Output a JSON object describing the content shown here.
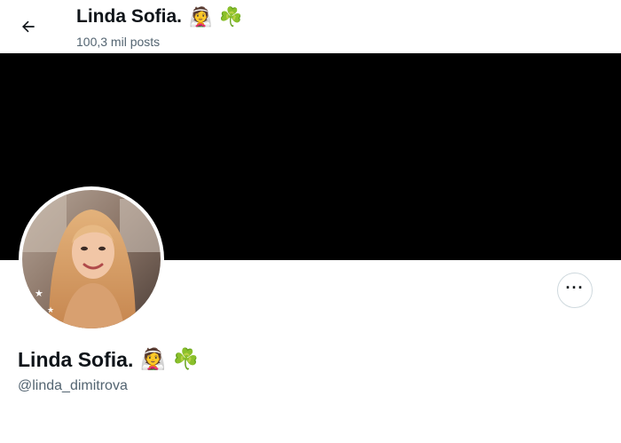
{
  "header": {
    "back_icon": "arrow-left-icon",
    "title": "Linda Sofia.",
    "emoji_1": "👰",
    "emoji_2": "☘️",
    "post_count": "100,3 mil posts"
  },
  "profile": {
    "name": "Linda Sofia.",
    "emoji_1": "👰",
    "emoji_2": "☘️",
    "handle": "@linda_dimitrova",
    "more_icon": "more-horizontal-icon",
    "more_label": "···"
  },
  "colors": {
    "banner": "#000000",
    "secondary_text": "#536471",
    "primary_text": "#0f1419",
    "border": "#cfd9de"
  }
}
